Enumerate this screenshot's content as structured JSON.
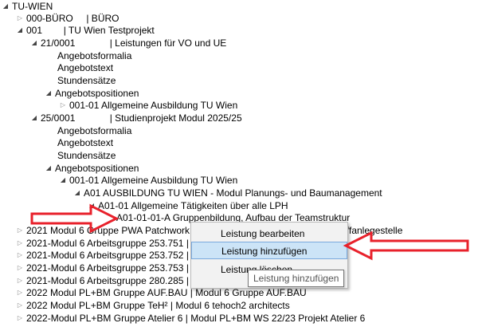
{
  "tree": [
    {
      "label": "TU-WIEN",
      "toggle": "expanded"
    },
    {
      "label": "000-BÜRO     | BÜRO",
      "toggle": "collapsed"
    },
    {
      "label": "001        | TU Wien Testprojekt",
      "toggle": "expanded"
    },
    {
      "label": "21/0001             | Leistungen für VO und UE",
      "toggle": "expanded"
    },
    {
      "label": "Angebotsformalia",
      "toggle": "none"
    },
    {
      "label": "Angebotstext",
      "toggle": "none"
    },
    {
      "label": "Stundensätze",
      "toggle": "none"
    },
    {
      "label": "Angebotspositionen",
      "toggle": "expanded"
    },
    {
      "label": "001-01 Allgemeine Ausbildung TU Wien",
      "toggle": "collapsed"
    },
    {
      "label": "25/0001             | Studienprojekt Modul 2025/25",
      "toggle": "expanded"
    },
    {
      "label": "Angebotsformalia",
      "toggle": "none"
    },
    {
      "label": "Angebotstext",
      "toggle": "none"
    },
    {
      "label": "Stundensätze",
      "toggle": "none"
    },
    {
      "label": "Angebotspositionen",
      "toggle": "expanded"
    },
    {
      "label": "001-01 Allgemeine Ausbildung TU Wien",
      "toggle": "expanded"
    },
    {
      "label": "A01 AUSBILDUNG TU WIEN - Modul Planungs- und Baumanagement",
      "toggle": "expanded"
    },
    {
      "label": "A01-01 Allgemeine Tätigkeiten über alle LPH",
      "toggle": "expanded"
    },
    {
      "label": "A01-01-01-A Gruppenbildung, Aufbau der Teamstruktur",
      "toggle": "none"
    },
    {
      "label": "2021 Modul 6 Gruppe PWA Patchwork Architecture | Modul 6 Station + Schiffanlegestelle",
      "toggle": "collapsed"
    },
    {
      "label": "2021-Modul 6 Arbeitsgruppe 253.751 | Vergabewesen und Vertragsrecht",
      "toggle": "collapsed"
    },
    {
      "label": "2021-Modul 6 Arbeitsgruppe 253.752 | Praxisnahe Architekturprojekte",
      "toggle": "collapsed"
    },
    {
      "label": "2021-Modul 6 Arbeitsgruppe 253.753 | Kommunikation Architekturprojekte",
      "toggle": "collapsed"
    },
    {
      "label": "2021-Modul 6 Arbeitsgruppe 280.285 | Vergabewesen und Vertragsrecht",
      "toggle": "collapsed"
    },
    {
      "label": "2022 Modul PL+BM Gruppe AUF.BAU | Modul 6 Gruppe AUF.BAU",
      "toggle": "collapsed"
    },
    {
      "label": "2022 Modul PL+BM Gruppe TeH² | Modul 6 tehoch2 architects",
      "toggle": "collapsed"
    },
    {
      "label": "2022-Modul PL+BM Gruppe Atelier 6 | Modul PL+BM WS 22/23 Projekt Atelier 6",
      "toggle": "collapsed"
    }
  ],
  "context_menu": {
    "items": [
      "Leistung bearbeiten",
      "Leistung hinzufügen",
      "Leistung löschen"
    ],
    "highlighted_index": 1
  },
  "tooltip": "Leistung hinzufügen",
  "annotation_color": "#e8212b"
}
